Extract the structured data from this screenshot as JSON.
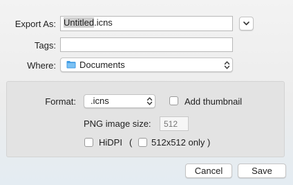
{
  "export": {
    "label": "Export As:",
    "name_selected": "Untitled",
    "name_extension": ".icns",
    "expand_icon": "chevron-down-icon"
  },
  "tags": {
    "label": "Tags:",
    "value": ""
  },
  "where": {
    "label": "Where:",
    "value": "Documents",
    "folder_icon": "folder-icon"
  },
  "options": {
    "format_label": "Format:",
    "format_value": ".icns",
    "add_thumbnail_label": "Add thumbnail",
    "add_thumbnail_checked": false,
    "png_size_label": "PNG image size:",
    "png_size_placeholder": "512",
    "hidpi_label": "HiDPI",
    "hidpi_checked": false,
    "paren_open": "(",
    "only_512_label": "512x512 only )",
    "only_512_checked": false
  },
  "buttons": {
    "cancel": "Cancel",
    "save": "Save"
  },
  "colors": {
    "folder_blue": "#3f9be4",
    "selection_gray": "#cfcfcf"
  }
}
